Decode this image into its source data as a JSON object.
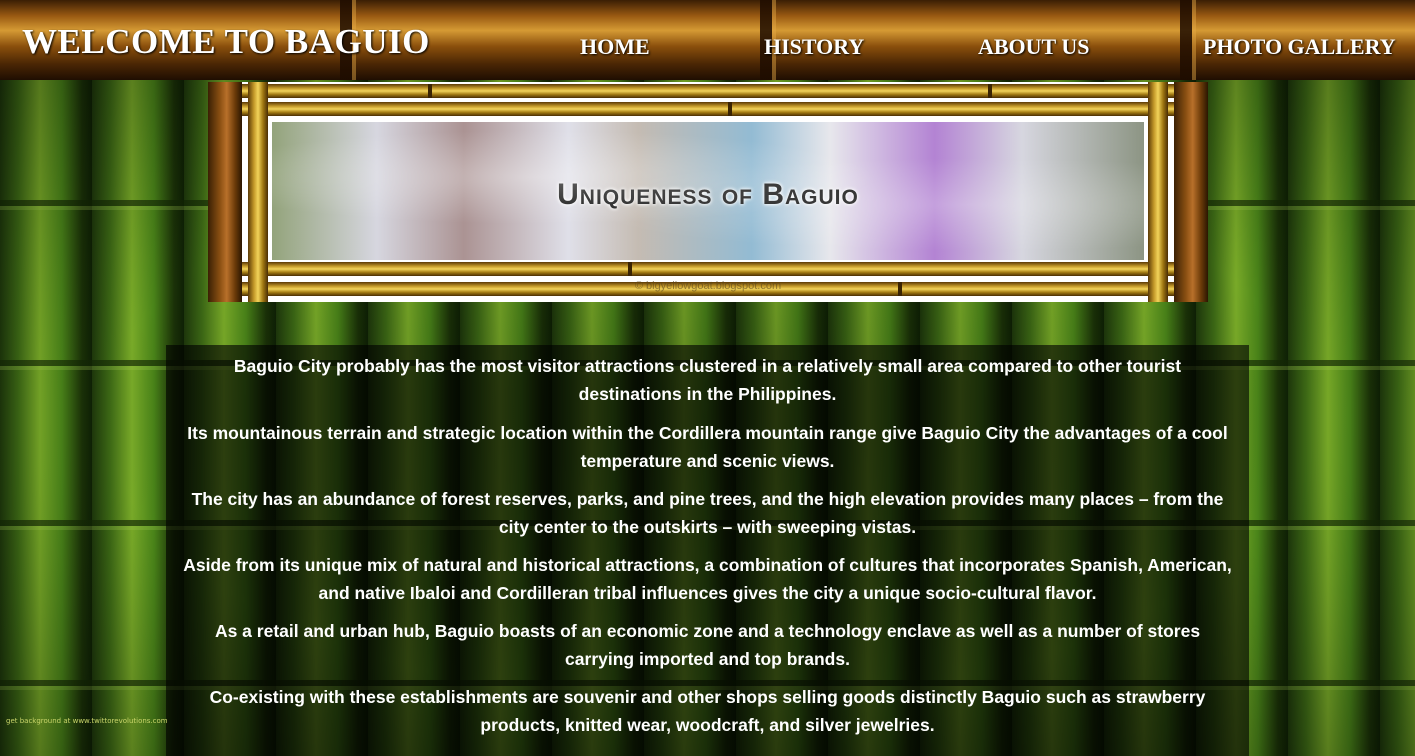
{
  "header": {
    "title": "WELCOME TO BAGUIO",
    "nav": {
      "home": "HOME",
      "history": "HISTORY",
      "about": "ABOUT US",
      "gallery": "PHOTO GALLERY"
    }
  },
  "banner": {
    "title": "Uniqueness of Baguio",
    "credit": "© bigyellowgoat.blogspot.com"
  },
  "content": {
    "paragraphs": [
      "Baguio City probably has the most visitor attractions clustered in a relatively small area compared to other tourist destinations in the Philippines.",
      "Its mountainous terrain and strategic location within the Cordillera mountain range give Baguio City the advantages of a cool temperature and scenic views.",
      "The city has an abundance of forest reserves, parks, and pine trees, and the high elevation provides many places – from the city center to the outskirts – with sweeping vistas.",
      "Aside from its unique mix of natural and historical attractions, a combination of cultures that incorporates Spanish, American, and native Ibaloi and Cordilleran tribal influences gives the city a unique socio-cultural flavor.",
      "As a retail and urban hub, Baguio boasts of an economic zone and a technology enclave as well as a number of stores carrying imported and top brands.",
      "Co-existing with these establishments are souvenir and other shops selling goods distinctly Baguio such as strawberry products, knitted wear, woodcraft, and silver jewelries."
    ]
  },
  "background_credit": "get background at www.twittorevolutions.com",
  "colors": {
    "header_wood": "#9a5a12",
    "bamboo_green": "#4d8a1a",
    "bamboo_frame_yellow": "#f2d35a",
    "text": "#ffffff",
    "content_overlay": "rgba(0,0,0,0.62)"
  }
}
